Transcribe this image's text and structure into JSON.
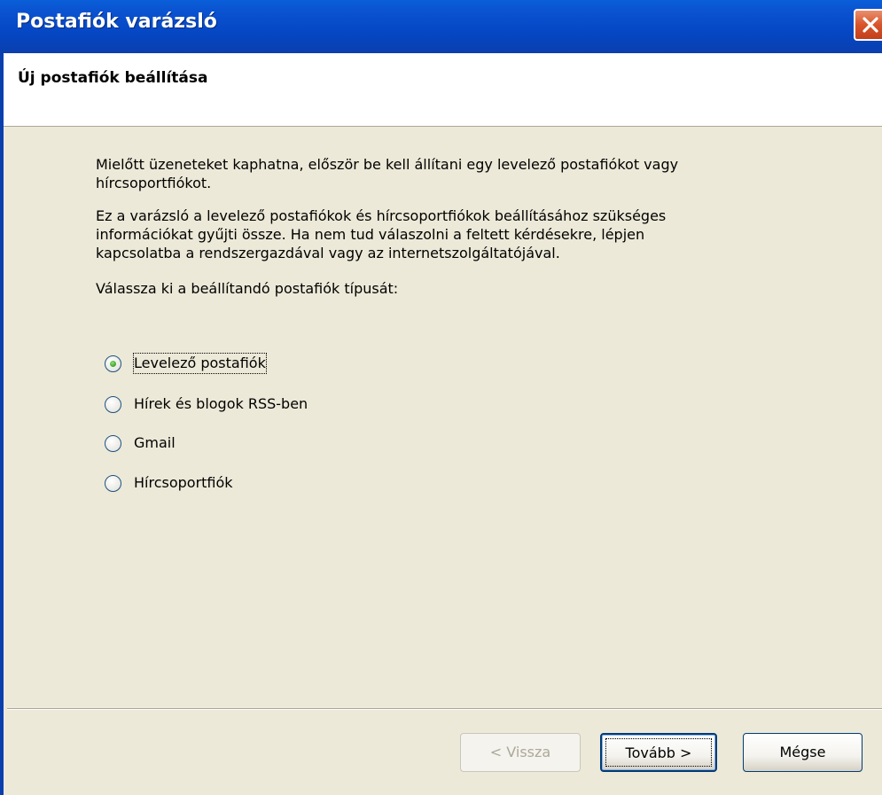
{
  "window": {
    "title": "Postafiók varázsló"
  },
  "header": {
    "heading": "Új postafiók beállítása"
  },
  "intro": {
    "line1": "Mielőtt üzeneteket kaphatna, először be kell állítani egy levelező postafiókot vagy",
    "line2": "hírcsoportfiókot.",
    "line3": "Ez a varázsló a levelező postafiókok és hírcsoportfiókok beállításához szükséges",
    "line4": "információkat gyűjti össze. Ha nem tud válaszolni a feltett kérdésekre, lépjen",
    "line5": "kapcsolatba a rendszergazdával vagy az internetszolgáltatójával.",
    "prompt": "Válassza ki a beállítandó postafiók típusát:"
  },
  "account_types": {
    "selected": "Levelező postafiók",
    "options": [
      {
        "label": "Levelező postafiók",
        "checked": true
      },
      {
        "label": "Hírek és blogok RSS-ben",
        "checked": false
      },
      {
        "label": "Gmail",
        "checked": false
      },
      {
        "label": "Hírcsoportfiók",
        "checked": false
      }
    ]
  },
  "buttons": {
    "back": "< Vissza",
    "next": "Tovább >",
    "cancel": "Mégse"
  },
  "colors": {
    "titlebar": "#0a53d1",
    "dialog_bg": "#ece9d8",
    "close_button": "#d9532a",
    "radio_selected": "#3ea22a"
  }
}
